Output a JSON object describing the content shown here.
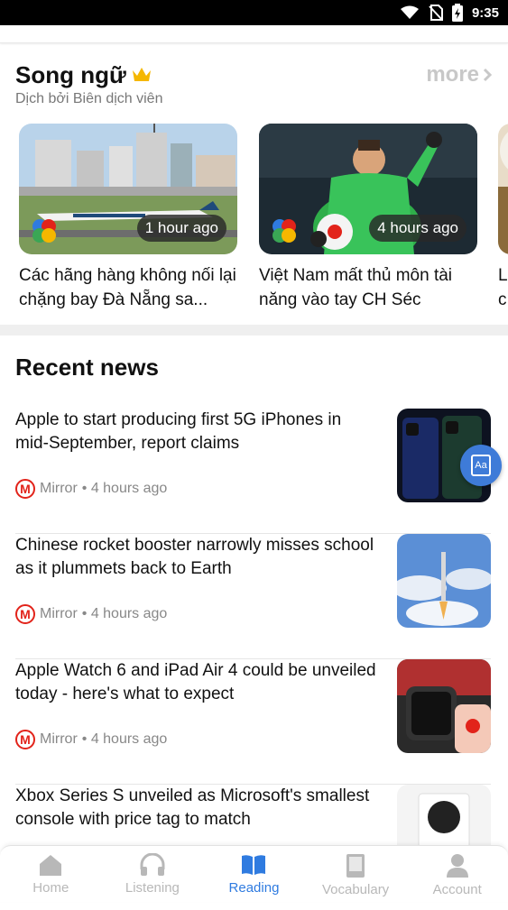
{
  "status_bar": {
    "time": "9:35"
  },
  "song_ngu": {
    "title": "Song ngữ",
    "subtitle": "Dịch bởi Biên dịch viên",
    "more_label": "more",
    "cards": [
      {
        "badge": "1 hour ago",
        "title": "Các hãng hàng không nối lại chặng bay Đà Nẵng sa..."
      },
      {
        "badge": "4 hours ago",
        "title": "Việt Nam mất thủ môn tài năng vào tay CH Séc"
      },
      {
        "badge": "",
        "title": "L c"
      }
    ]
  },
  "recent": {
    "title": "Recent news",
    "items": [
      {
        "title": "Apple to start producing first 5G iPhones in mid-September, report claims",
        "source": "Mirror",
        "time": "• 4 hours ago"
      },
      {
        "title": "Chinese rocket booster narrowly misses school as it plummets back to Earth",
        "source": "Mirror",
        "time": "• 4 hours ago"
      },
      {
        "title": "Apple Watch 6 and iPad Air 4 could be unveiled today - here's what to expect",
        "source": "Mirror",
        "time": "• 4 hours ago"
      },
      {
        "title": "Xbox Series S unveiled as Microsoft's smallest console with price tag to match",
        "source": "",
        "time": ""
      }
    ]
  },
  "float_button": {
    "label": "Aa"
  },
  "bottom_nav": {
    "items": [
      {
        "label": "Home",
        "icon": "home-icon"
      },
      {
        "label": "Listening",
        "icon": "headphones-icon"
      },
      {
        "label": "Reading",
        "icon": "book-icon"
      },
      {
        "label": "Vocabulary",
        "icon": "notebook-icon"
      },
      {
        "label": "Account",
        "icon": "person-icon"
      }
    ],
    "active": "Reading",
    "active_color": "#2f7be0",
    "inactive_color": "#b8b8b8"
  },
  "colors": {
    "accent": "#2f7be0",
    "crown": "#f5b700",
    "mirror_red": "#e2231a"
  }
}
